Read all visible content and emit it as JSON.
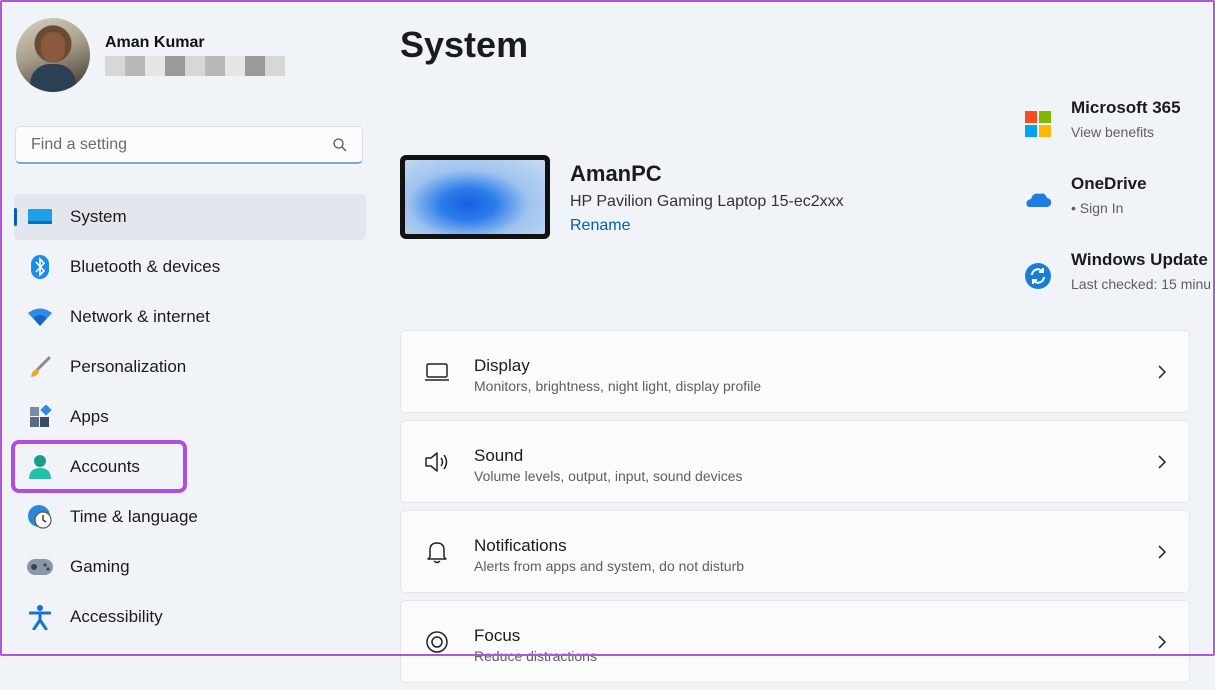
{
  "profile": {
    "name": "Aman Kumar"
  },
  "search": {
    "placeholder": "Find a setting"
  },
  "nav": [
    {
      "label": "System",
      "icon": "system-icon"
    },
    {
      "label": "Bluetooth & devices",
      "icon": "bluetooth-icon"
    },
    {
      "label": "Network & internet",
      "icon": "wifi-icon"
    },
    {
      "label": "Personalization",
      "icon": "brush-icon"
    },
    {
      "label": "Apps",
      "icon": "apps-icon"
    },
    {
      "label": "Accounts",
      "icon": "accounts-icon"
    },
    {
      "label": "Time & language",
      "icon": "globe-clock-icon"
    },
    {
      "label": "Gaming",
      "icon": "gamepad-icon"
    },
    {
      "label": "Accessibility",
      "icon": "accessibility-icon"
    }
  ],
  "main": {
    "title": "System",
    "device": {
      "name": "AmanPC",
      "model": "HP Pavilion Gaming Laptop 15-ec2xxx",
      "rename": "Rename"
    },
    "quick": [
      {
        "title": "Microsoft 365",
        "sub": "View benefits"
      },
      {
        "title": "OneDrive",
        "sub": "• Sign In"
      },
      {
        "title": "Windows Update",
        "sub": "Last checked: 15 minu"
      }
    ],
    "cards": [
      {
        "title": "Display",
        "sub": "Monitors, brightness, night light, display profile"
      },
      {
        "title": "Sound",
        "sub": "Volume levels, output, input, sound devices"
      },
      {
        "title": "Notifications",
        "sub": "Alerts from apps and system, do not disturb"
      },
      {
        "title": "Focus",
        "sub": "Reduce distractions"
      }
    ]
  },
  "colors": {
    "accent": "#005fb8",
    "highlight": "#b14ee0",
    "background": "#f0f4f9"
  }
}
